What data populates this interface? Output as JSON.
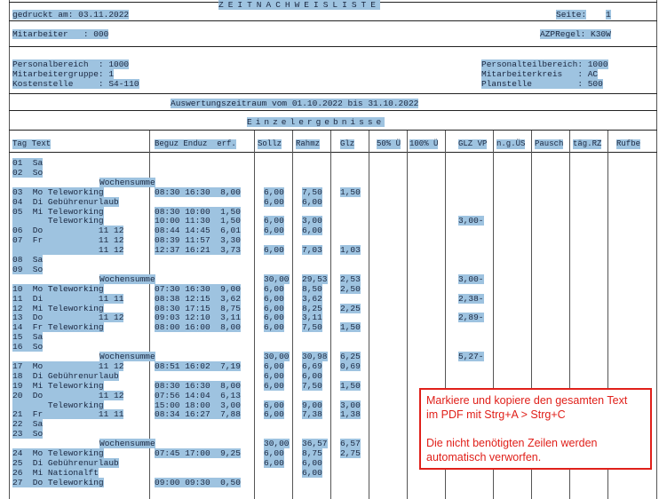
{
  "header": {
    "title": "ZEITNACHWEISLISTE",
    "printed": "gedruckt am: 03.11.2022",
    "page_label": "Seite:",
    "page_no": "1",
    "employee": "Mitarbeiter   : 000",
    "azp_rule": "AZPRegel: K30W",
    "personnel_area": "Personalbereich  : 1000",
    "employee_group": "Mitarbeitergruppe: 1",
    "cost_center": "Kostenstelle     : S4-110",
    "personnel_subarea": "Personalteilbereich: 1000",
    "employee_circle": "Mitarbeiterkreis   : AC",
    "plan_position": "Planstelle         : 500",
    "period": "Auswertungszeitraum vom 01.10.2022 bis 31.10.2022",
    "section": "Einzelergebnisse"
  },
  "columns": {
    "day": "Tag Text",
    "times": "Beguz Enduz  erf.",
    "sollz": "Sollz",
    "rahmz": "Rahmz",
    "glz": "Glz",
    "p50": "50% Ü",
    "p100": "100% Ü",
    "glzvp": "GLZ VP",
    "ngus": "n.g.ÜS",
    "pausch": "Pausch",
    "tagrz": "täg.RZ",
    "rufbe": "Rufbe"
  },
  "rows": [
    {
      "tag": "01  Sa"
    },
    {
      "tag": "02  So"
    },
    {
      "sum": "Wochensumme"
    },
    {
      "tag": "03  Mo Teleworking",
      "t": "08:30 16:30  8,00",
      "s": "6,00",
      "r": "7,50",
      "g": "1,50"
    },
    {
      "tag": "04  Di Gebührenurlaub",
      "s": "6,00",
      "r": "6,00"
    },
    {
      "tag": "05  Mi Teleworking",
      "t": "08:30 10:00  1,50"
    },
    {
      "tag": "       Teleworking",
      "t": "10:00 11:30  1,50",
      "s": "6,00",
      "r": "3,00",
      "vp": "3,00-"
    },
    {
      "tag": "06  Do           11 12",
      "t": "08:44 14:45  6,01",
      "s": "6,00",
      "r": "6,00"
    },
    {
      "tag": "07  Fr           11 12",
      "t": "08:39 11:57  3,30"
    },
    {
      "tag": "                 11 12",
      "t": "12:37 16:21  3,73",
      "s": "6,00",
      "r": "7,03",
      "g": "1,03"
    },
    {
      "tag": "08  Sa"
    },
    {
      "tag": "09  So"
    },
    {
      "sum": "Wochensumme",
      "s": "30,00",
      "r": "29,53",
      "g": "2,53",
      "vp": "3,00-"
    },
    {
      "tag": "10  Mo Teleworking",
      "t": "07:30 16:30  9,00",
      "s": "6,00",
      "r": "8,50",
      "g": "2,50"
    },
    {
      "tag": "11  Di           11 11",
      "t": "08:38 12:15  3,62",
      "s": "6,00",
      "r": "3,62",
      "vp": "2,38-"
    },
    {
      "tag": "12  Mi Teleworking",
      "t": "08:30 17:15  8,75",
      "s": "6,00",
      "r": "8,25",
      "g": "2,25"
    },
    {
      "tag": "13  Do           11 12",
      "t": "09:03 12:10  3,11",
      "s": "6,00",
      "r": "3,11",
      "vp": "2,89-"
    },
    {
      "tag": "14  Fr Teleworking",
      "t": "08:00 16:00  8,00",
      "s": "6,00",
      "r": "7,50",
      "g": "1,50"
    },
    {
      "tag": "15  Sa"
    },
    {
      "tag": "16  So"
    },
    {
      "sum": "Wochensumme",
      "s": "30,00",
      "r": "30,98",
      "g": "6,25",
      "vp": "5,27-"
    },
    {
      "tag": "17  Mo           11 12",
      "t": "08:51 16:02  7,19",
      "s": "6,00",
      "r": "6,69",
      "g": "0,69"
    },
    {
      "tag": "18  Di Gebührenurlaub",
      "s": "6,00",
      "r": "6,00"
    },
    {
      "tag": "19  Mi Teleworking",
      "t": "08:30 16:30  8,00",
      "s": "6,00",
      "r": "7,50",
      "g": "1,50"
    },
    {
      "tag": "20  Do           11 12",
      "t": "07:56 14:04  6,13"
    },
    {
      "tag": "       Teleworking",
      "t": "15:00 18:00  3,00",
      "s": "6,00",
      "r": "9,00",
      "g": "3,00"
    },
    {
      "tag": "21  Fr           11 11",
      "t": "08:34 16:27  7,88",
      "s": "6,00",
      "r": "7,38",
      "g": "1,38"
    },
    {
      "tag": "22  Sa"
    },
    {
      "tag": "23  So"
    },
    {
      "sum": "Wochensumme",
      "s": "30,00",
      "r": "36,57",
      "g": "6,57"
    },
    {
      "tag": "24  Mo Teleworking",
      "t": "07:45 17:00  9,25",
      "s": "6,00",
      "r": "8,75",
      "g": "2,75"
    },
    {
      "tag": "25  Di Gebührenurlaub",
      "s": "6,00",
      "r": "6,00"
    },
    {
      "tag": "26  Mi Nationalft",
      "r": "6,00"
    },
    {
      "tag": "27  Do Teleworking",
      "t": "09:00 09:30  0,50"
    }
  ],
  "note": {
    "line1": "Markiere und kopiere den gesamten Text",
    "line2": "im PDF mit Strg+A  > Strg+C",
    "line3": "Die nicht benötigten Zeilen werden",
    "line4": "automatisch verworfen."
  },
  "colors": {
    "selection": "#9ec3e0",
    "note_red": "#e0201a"
  }
}
